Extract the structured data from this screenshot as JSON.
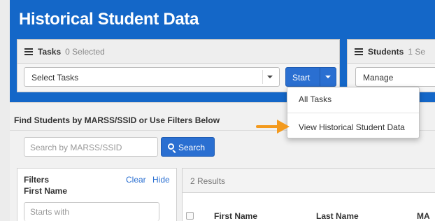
{
  "page": {
    "title": "Historical Student Data"
  },
  "tasks_panel": {
    "header": "Tasks",
    "selected_count": "0 Selected",
    "select_label": "Select Tasks",
    "start_label": "Start"
  },
  "students_panel": {
    "header": "Students",
    "selected_fragment": "1 Se",
    "manage_label": "Manage"
  },
  "start_menu": {
    "items": [
      "All Tasks",
      "View Historical Student Data"
    ]
  },
  "find": {
    "title": "Find Students by MARSS/SSID or Use Filters Below",
    "search_placeholder": "Search by MARSS/SSID",
    "search_button": "Search"
  },
  "filters": {
    "title": "Filters",
    "clear": "Clear",
    "hide": "Hide",
    "first_name_label": "First Name",
    "first_name_placeholder": "Starts with"
  },
  "results": {
    "count_label": "2 Results",
    "columns": [
      "First Name",
      "Last Name",
      "MA"
    ]
  },
  "colors": {
    "header_blue": "#1467c8",
    "button_blue": "#2a6fd1",
    "arrow_orange": "#f39a1e"
  }
}
